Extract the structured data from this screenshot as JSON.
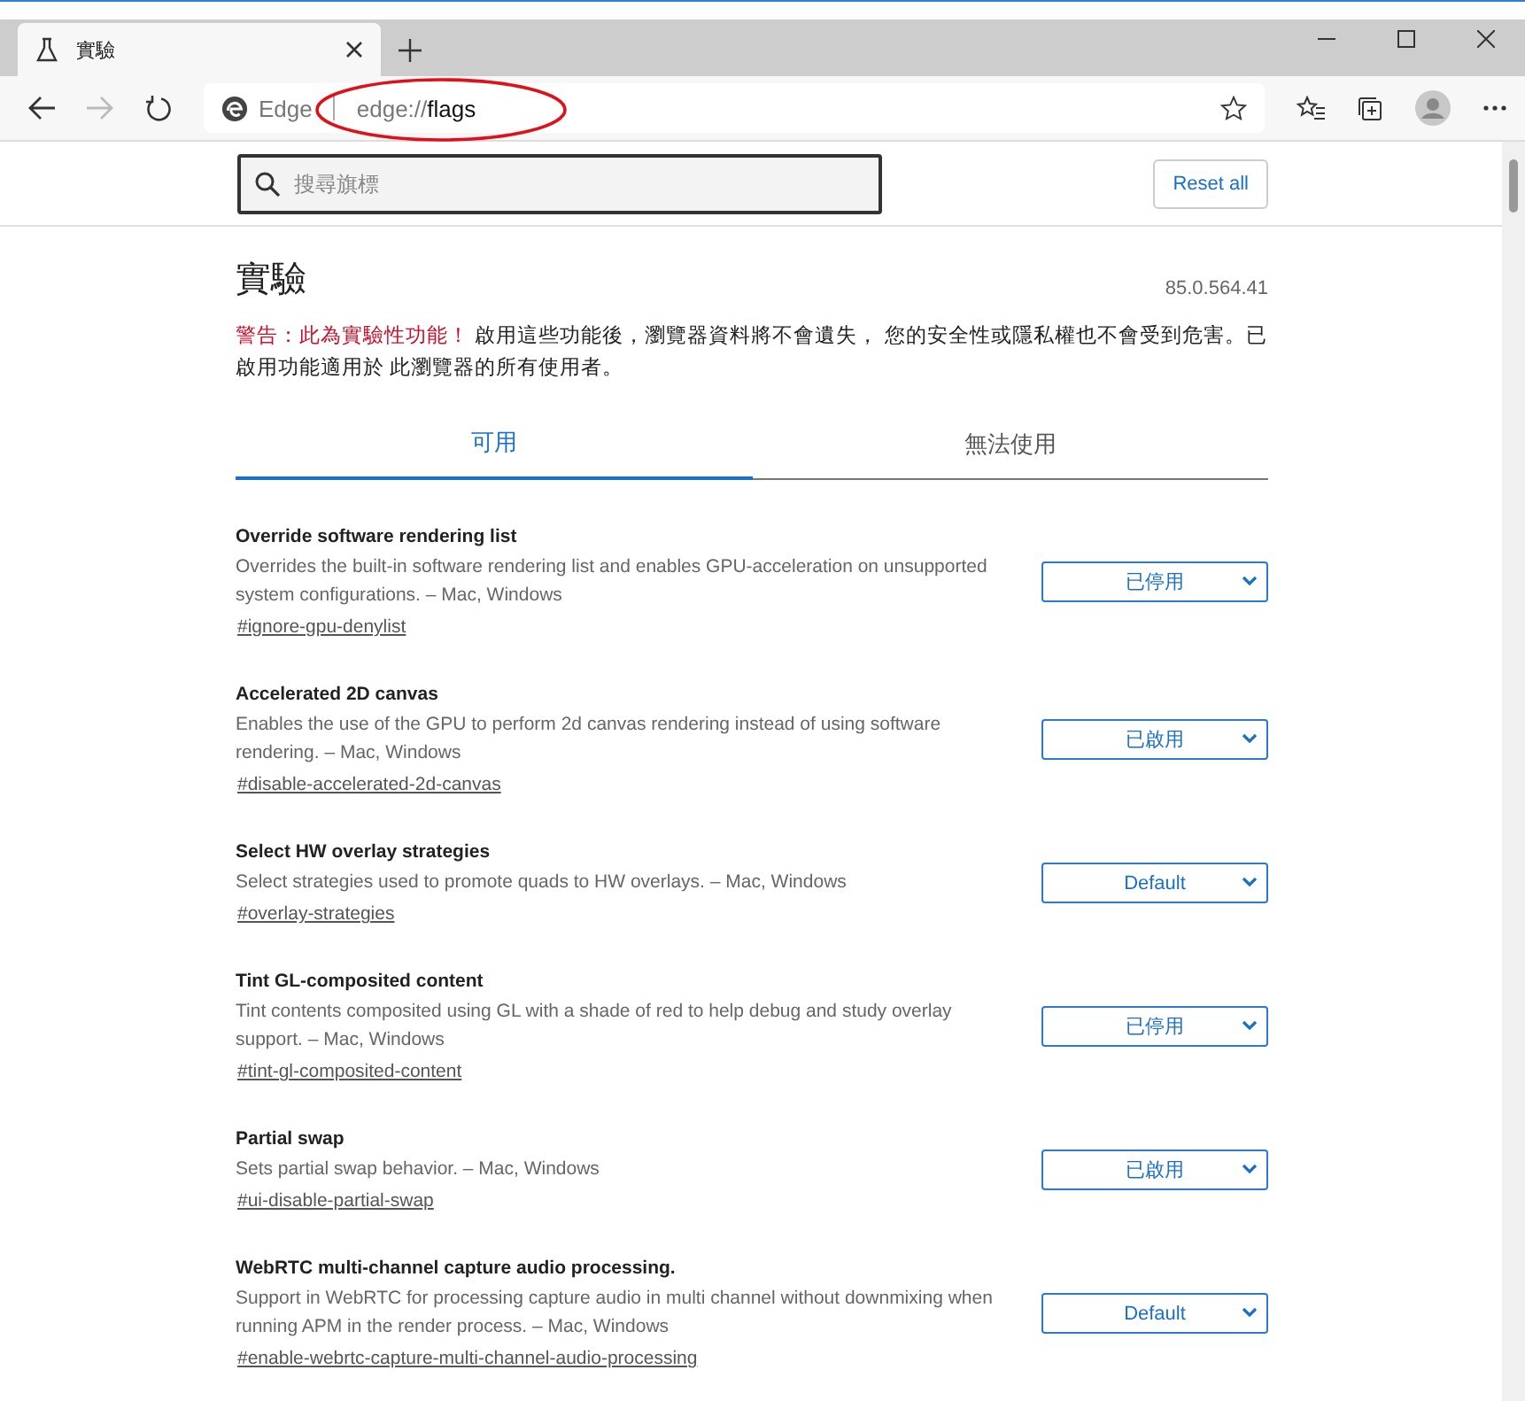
{
  "browser": {
    "tab": {
      "title": "實驗"
    },
    "address": {
      "site": "Edge",
      "url_prefix": "edge://",
      "url_path": "flags"
    }
  },
  "search": {
    "placeholder": "搜尋旗標"
  },
  "reset_button": "Reset all",
  "title": "實驗",
  "version": "85.0.564.41",
  "warning": {
    "lead": "警告：此為實驗性功能！",
    "text": "啟用這些功能後，瀏覽器資料將不會遺失， 您的安全性或隱私權也不會受到危害。已啟用功能適用於 此瀏覽器的所有使用者。"
  },
  "tabs": [
    {
      "label": "可用",
      "selected": true
    },
    {
      "label": "無法使用",
      "selected": false
    }
  ],
  "flags": [
    {
      "name": "Override software rendering list",
      "description": "Overrides the built-in software rendering list and enables GPU-acceleration on unsupported system configurations. – Mac, Windows",
      "link": "#ignore-gpu-denylist",
      "value": "已停用"
    },
    {
      "name": "Accelerated 2D canvas",
      "description": "Enables the use of the GPU to perform 2d canvas rendering instead of using software rendering. – Mac, Windows",
      "link": "#disable-accelerated-2d-canvas",
      "value": "已啟用"
    },
    {
      "name": "Select HW overlay strategies",
      "description": "Select strategies used to promote quads to HW overlays. – Mac, Windows",
      "link": "#overlay-strategies",
      "value": "Default"
    },
    {
      "name": "Tint GL-composited content",
      "description": "Tint contents composited using GL with a shade of red to help debug and study overlay support. – Mac, Windows",
      "link": "#tint-gl-composited-content",
      "value": "已停用"
    },
    {
      "name": "Partial swap",
      "description": "Sets partial swap behavior. – Mac, Windows",
      "link": "#ui-disable-partial-swap",
      "value": "已啟用"
    },
    {
      "name": "WebRTC multi-channel capture audio processing.",
      "description": "Support in WebRTC for processing capture audio in multi channel without downmixing when running APM in the render process. – Mac, Windows",
      "link": "#enable-webrtc-capture-multi-channel-audio-processing",
      "value": "Default"
    }
  ]
}
